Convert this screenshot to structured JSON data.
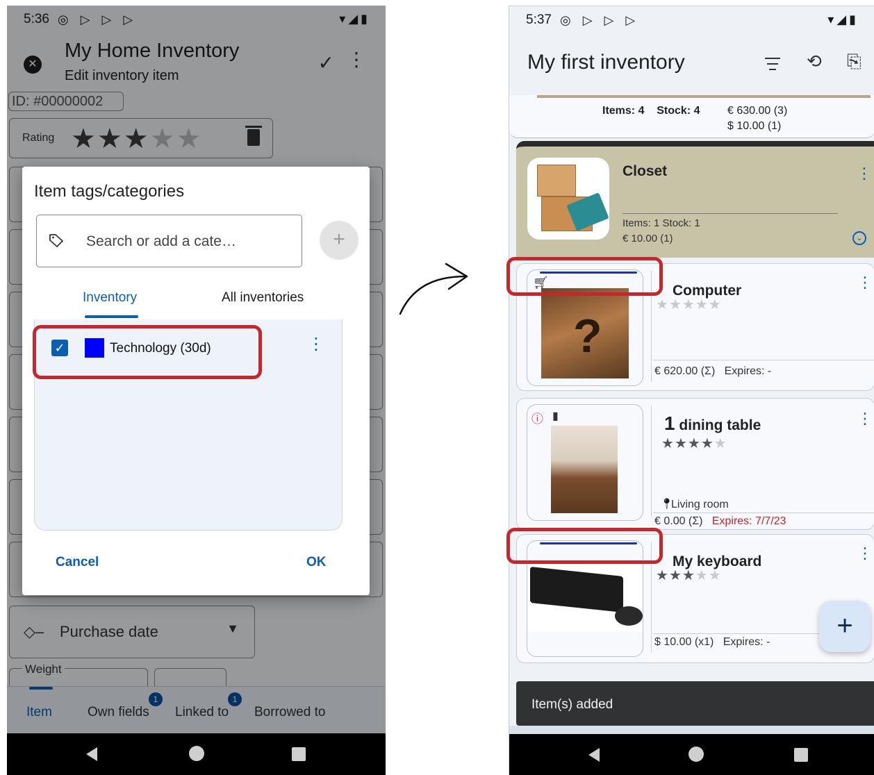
{
  "left": {
    "status": {
      "time": "5:36",
      "icons": "◎ ▷ ▷ ▷",
      "right_icons": "▾◢▮"
    },
    "appbar": {
      "title": "My Home Inventory",
      "subtitle": "Edit inventory item"
    },
    "form": {
      "id_value": "ID: #00000002",
      "rating_label": "Rating",
      "rating": 3,
      "rating_max": 5,
      "purchase_date_label": "Purchase date",
      "weight_label": "Weight"
    },
    "dialog": {
      "title": "Item tags/categories",
      "search_placeholder": "Search or add a cate…",
      "add_label": "+",
      "tabs": [
        "Inventory",
        "All inventories"
      ],
      "active_tab": "Inventory",
      "tags": [
        {
          "label": "Technology (30d)",
          "checked": true,
          "color": "#0000ff"
        }
      ],
      "cancel_label": "Cancel",
      "ok_label": "OK"
    },
    "bottom_tabs": [
      {
        "label": "Item",
        "badge": ""
      },
      {
        "label": "Own fields",
        "badge": "1"
      },
      {
        "label": "Linked to",
        "badge": "1"
      },
      {
        "label": "Borrowed to",
        "badge": ""
      }
    ]
  },
  "right": {
    "status": {
      "time": "5:37",
      "icons": "◎ ▷ ▷ ▷",
      "right_icons": "▾◢▮"
    },
    "appbar": {
      "title": "My first inventory",
      "icon_names": [
        "filter-icon",
        "settings-history-icon",
        "export-icon"
      ]
    },
    "summary": {
      "items_label": "Items: 4",
      "stock_label": "Stock: 4",
      "currency1": "€ 630.00 (3)",
      "currency2": "$ 10.00 (1)"
    },
    "closet": {
      "name": "Closet",
      "stats": "Items:  1   Stock:  1",
      "price": "€ 10.00 (1)"
    },
    "items": [
      {
        "name": "Computer",
        "qty": "",
        "rating": 0,
        "location": "",
        "price": "€ 620.00 (Σ)",
        "expires": "Expires: -",
        "expired": false,
        "icon": "cart-icon"
      },
      {
        "name": "dining table",
        "qty": "1",
        "rating": 4,
        "location": "Living room",
        "price": "€ 0.00 (Σ)",
        "expires": "Expires: 7/7/23",
        "expired": true,
        "icon": "alert-icon"
      },
      {
        "name": "My keyboard",
        "qty": "",
        "rating": 3,
        "location": "",
        "price": "$ 10.00 (x1)",
        "expires": "Expires: -",
        "expired": false,
        "icon": ""
      }
    ],
    "fab_label": "+",
    "snackbar": "Item(s) added"
  },
  "colors": {
    "accent": "#0b5eb0",
    "highlight": "#c4282c",
    "tag": "#0000ff",
    "expired": "#d0202a"
  }
}
